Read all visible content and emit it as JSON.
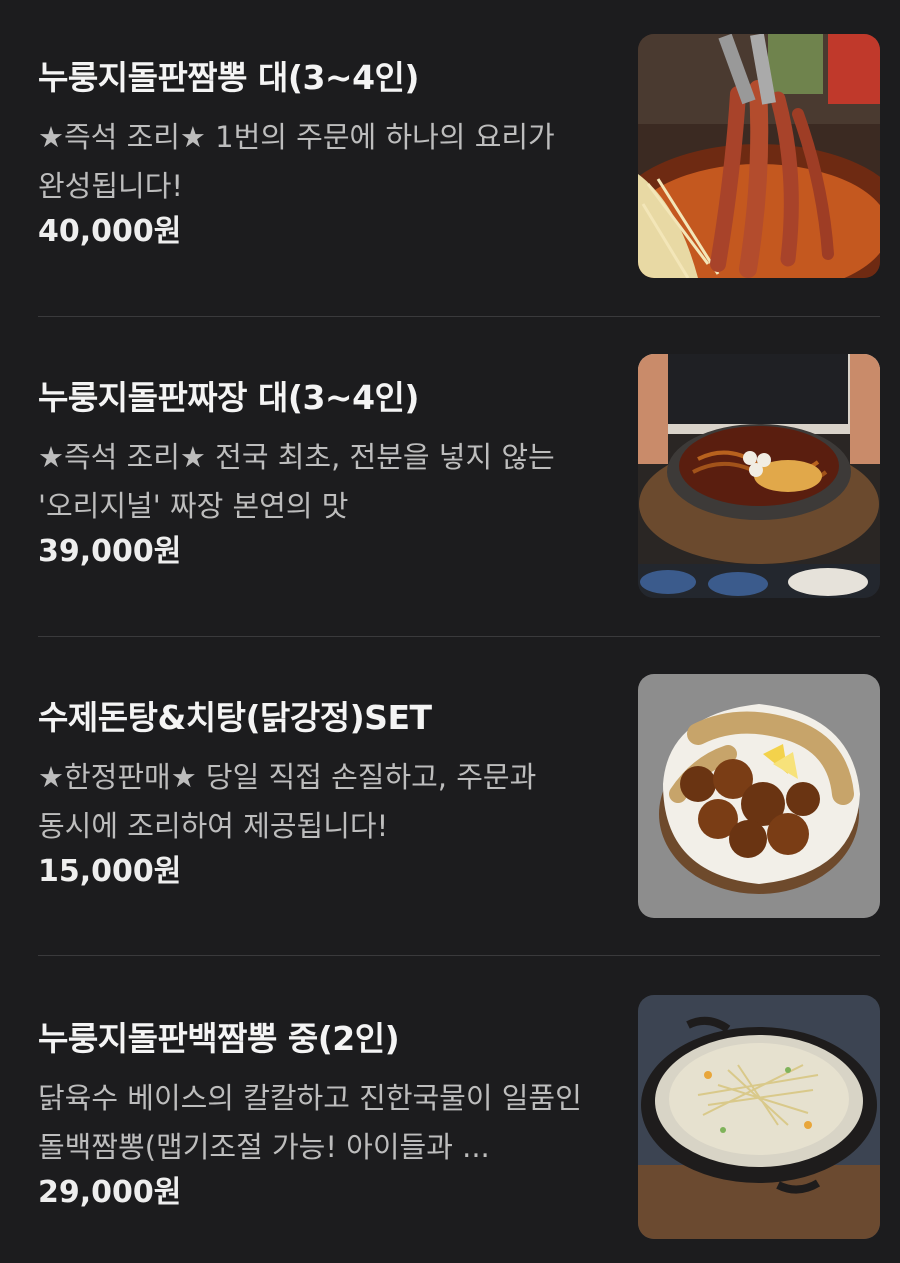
{
  "menu": {
    "items": [
      {
        "title": "누룽지돌판짬뽕 대(3~4인)",
        "description": "★즉석 조리★ 1번의 주문에 하나의 요리가 완성됩니다!",
        "price": "40,000원",
        "image_icon": "food-photo-octopus-jjamppong-icon"
      },
      {
        "title": "누룽지돌판짜장 대(3~4인)",
        "description": "★즉석 조리★ 전국 최초, 전분을 넣지 않는 '오리지널' 짜장 본연의 맛",
        "price": "39,000원",
        "image_icon": "food-photo-jjajang-icon"
      },
      {
        "title": "수제돈탕&치탕(닭강정)SET",
        "description": "★한정판매★ 당일 직접 손질하고, 주문과 동시에 조리하여 제공됩니다!",
        "price": "15,000원",
        "image_icon": "food-photo-fried-chicken-icon"
      },
      {
        "title": "누룽지돌판백짬뽕 중(2인)",
        "description": "닭육수 베이스의 칼칼하고 진한국물이 일품인 돌백짬뽕(맵기조절 가능! 아이들과 ...",
        "price": "29,000원",
        "image_icon": "food-photo-white-jjamppong-icon"
      }
    ]
  },
  "colors": {
    "background": "#1c1c1e",
    "title": "#f4f4f4",
    "description": "#bdbdbd",
    "price": "#eeeeee",
    "divider": "#3a3a3c"
  }
}
